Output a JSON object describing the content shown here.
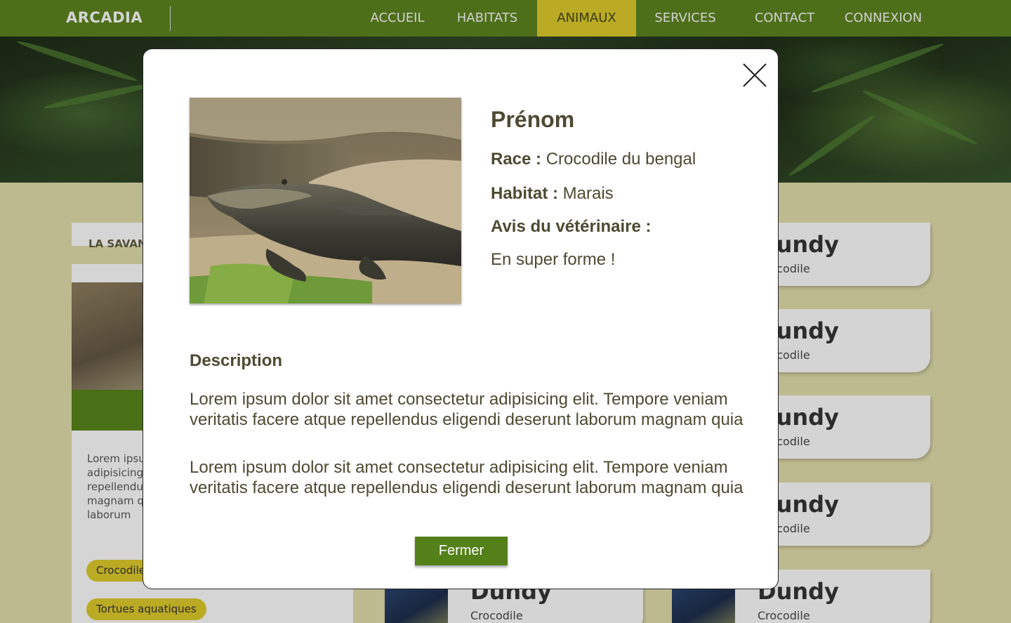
{
  "navbar": {
    "logo": "ARCADIA",
    "items": [
      {
        "label": "ACCUEIL",
        "active": false
      },
      {
        "label": "HABITATS",
        "active": false
      },
      {
        "label": "ANIMAUX",
        "active": true
      },
      {
        "label": "SERVICES",
        "active": false
      },
      {
        "label": "CONTACT",
        "active": false
      },
      {
        "label": "CONNEXION",
        "active": false
      }
    ]
  },
  "habitat": {
    "title": "LA SAVAN",
    "text": "Lorem ipsum dolor sit amet consectetur adipisicing elit. Tempore veniam facere atque repellendus eligendi deserunt laborum magnam quia veritatis facere deserunt laborum",
    "tags": [
      "Crocodile",
      "Tortues aquatiques"
    ]
  },
  "animal_cards": [
    {
      "name": "Dundy",
      "race": "Crocodile"
    },
    {
      "name": "Dundy",
      "race": "Crocodile"
    },
    {
      "name": "Dundy",
      "race": "Crocodile"
    },
    {
      "name": "Dundy",
      "race": "Crocodile"
    },
    {
      "name": "Dundy",
      "race": "Crocodile"
    },
    {
      "name": "Dundy",
      "race": "Crocodile"
    }
  ],
  "modal": {
    "name": "Prénom",
    "race_label": "Race :",
    "race_value": "Crocodile du bengal",
    "habitat_label": "Habitat :",
    "habitat_value": "Marais",
    "vet_label": "Avis du vétérinaire :",
    "vet_value": "En super forme !",
    "description_title": "Description",
    "paragraphs": [
      "Lorem ipsum dolor sit amet consectetur adipisicing elit. Tempore veniam veritatis facere atque repellendus eligendi deserunt laborum magnam quia",
      "Lorem ipsum dolor sit amet consectetur adipisicing elit. Tempore veniam veritatis facere atque repellendus eligendi deserunt laborum magnam quia"
    ],
    "close_button": "Fermer",
    "image_icon": "crocodile-photo",
    "close_icon": "close-icon"
  },
  "colors": {
    "nav_bg": "#597f1d",
    "nav_active": "#d4c22a",
    "page_bg": "#d8d4a4",
    "button_green": "#54801a",
    "text_dark": "#4d4a32"
  }
}
